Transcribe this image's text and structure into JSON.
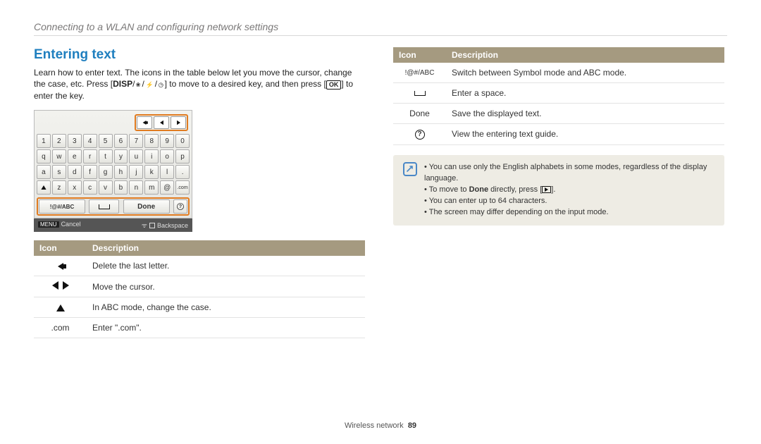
{
  "sectionHeader": "Connecting to a WLAN and configuring network settings",
  "title": "Entering text",
  "intro": {
    "line1": "Learn how to enter text. The icons in the table below let you move the cursor, change the case, etc. Press [",
    "disp": "DISP",
    "mid": "] to move to a desired key, and then press [",
    "ok": "OK",
    "end": "] to enter the key."
  },
  "keyboard": {
    "rows": [
      [
        "1",
        "2",
        "3",
        "4",
        "5",
        "6",
        "7",
        "8",
        "9",
        "0"
      ],
      [
        "q",
        "w",
        "e",
        "r",
        "t",
        "y",
        "u",
        "i",
        "o",
        "p"
      ],
      [
        "a",
        "s",
        "d",
        "f",
        "g",
        "h",
        "j",
        "k",
        "l",
        "."
      ]
    ],
    "row4": {
      "shift": "↑",
      "keys": [
        "z",
        "x",
        "c",
        "v",
        "b",
        "n",
        "m",
        "@"
      ],
      "com": ".com"
    },
    "bottom": {
      "mode": "!@#/ABC",
      "space": "⎵",
      "done": "Done",
      "help": "?"
    },
    "status": {
      "menu": "MENU",
      "cancel": "Cancel",
      "backspace": "Backspace"
    }
  },
  "tableHeaders": {
    "icon": "Icon",
    "desc": "Description"
  },
  "leftTable": [
    {
      "icon": "back",
      "text": "Delete the last letter."
    },
    {
      "icon": "leftright",
      "text": "Move the cursor."
    },
    {
      "icon": "up",
      "text": "In ABC mode, change the case."
    },
    {
      "icon": "com",
      "label": ".com",
      "text": "Enter \".com\"."
    }
  ],
  "rightTable": [
    {
      "icon": "mode",
      "label": "!@#/ABC",
      "text": "Switch between Symbol mode and ABC mode."
    },
    {
      "icon": "space",
      "text": "Enter a space."
    },
    {
      "icon": "done",
      "label": "Done",
      "text": "Save the displayed text."
    },
    {
      "icon": "help",
      "text": "View the entering text guide."
    }
  ],
  "notes": [
    "You can use only the English alphabets in some modes, regardless of the display language.",
    "To move to Done directly, press [▶].",
    "You can enter up to 64 characters.",
    "The screen may differ depending on the input mode."
  ],
  "note_done_word": "Done",
  "note_prefix": "To move to ",
  "note_suffix1": " directly, press [",
  "note_suffix2": "].",
  "footer": {
    "label": "Wireless network",
    "page": "89"
  }
}
